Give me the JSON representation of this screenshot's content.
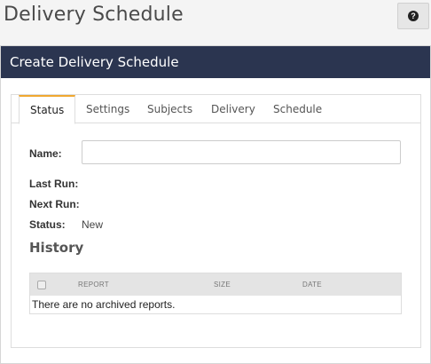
{
  "page": {
    "title": "Delivery Schedule",
    "help_icon": "question-circle-icon"
  },
  "panel": {
    "title": "Create Delivery Schedule"
  },
  "tabs": [
    {
      "label": "Status",
      "active": true
    },
    {
      "label": "Settings",
      "active": false
    },
    {
      "label": "Subjects",
      "active": false
    },
    {
      "label": "Delivery",
      "active": false
    },
    {
      "label": "Schedule",
      "active": false
    }
  ],
  "status_form": {
    "name_label": "Name:",
    "name_value": "",
    "last_run_label": "Last Run:",
    "last_run_value": "",
    "next_run_label": "Next Run:",
    "next_run_value": "",
    "status_label": "Status:",
    "status_value": "New"
  },
  "history": {
    "title": "History",
    "columns": [
      "REPORT",
      "SIZE",
      "DATE"
    ],
    "empty_message": "There are no archived reports."
  },
  "colors": {
    "header_bg": "#2b3550",
    "active_tab_accent": "#f0a830"
  }
}
